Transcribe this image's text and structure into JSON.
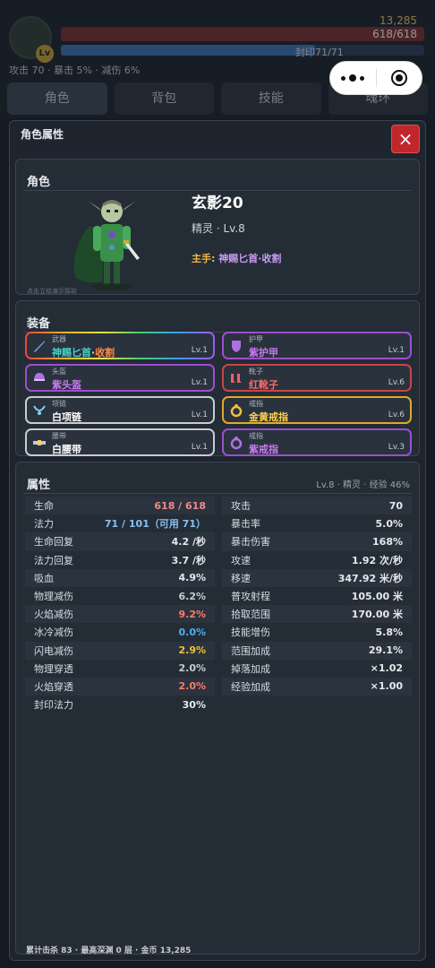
{
  "hud": {
    "gold": "13,285",
    "hp_text": "618/618",
    "seal_text": "封印71/71",
    "statline": "攻击 70  ·  暴击 5%  ·  减伤 6%",
    "tabs": [
      "角色",
      "背包",
      "技能",
      "魂环"
    ]
  },
  "modal": {
    "title": "角色属性",
    "close": "×"
  },
  "character": {
    "section": "角色",
    "name": "玄影20",
    "race_level": "精灵 · Lv.8",
    "mainhand_label": "主手:",
    "mainhand_name": "神赐匕首·收割",
    "hint": "点击立绘演示挥砍"
  },
  "equipment": {
    "section": "装备",
    "slots": [
      {
        "type": "武器",
        "name_a": "神赐匕首",
        "name_b": "·",
        "name_c": "收割",
        "lv": "Lv.1",
        "rarity": "rainbow",
        "icon": "dagger-icon"
      },
      {
        "type": "护甲",
        "name": "紫护甲",
        "lv": "Lv.1",
        "rarity": "purple",
        "icon": "armor-icon"
      },
      {
        "type": "头盔",
        "name": "紫头盔",
        "lv": "Lv.1",
        "rarity": "purple",
        "icon": "helmet-icon"
      },
      {
        "type": "靴子",
        "name": "红靴子",
        "lv": "Lv.6",
        "rarity": "red",
        "icon": "boots-icon"
      },
      {
        "type": "项链",
        "name": "白项链",
        "lv": "Lv.1",
        "rarity": "white",
        "icon": "necklace-icon"
      },
      {
        "type": "戒指",
        "name": "金黄戒指",
        "lv": "Lv.6",
        "rarity": "gold",
        "icon": "ring-icon"
      },
      {
        "type": "腰带",
        "name": "白腰带",
        "lv": "Lv.1",
        "rarity": "white",
        "icon": "belt-icon"
      },
      {
        "type": "戒指",
        "name": "紫戒指",
        "lv": "Lv.3",
        "rarity": "purple",
        "icon": "ring-icon"
      }
    ]
  },
  "attributes": {
    "section": "属性",
    "meta": "Lv.8 · 精灵 · 经验 46%",
    "left": [
      {
        "k": "生命",
        "v": "618 / 618",
        "c": "pink"
      },
      {
        "k": "法力",
        "v": "71 / 101（可用 71）",
        "c": "blue"
      },
      {
        "k": "生命回复",
        "v": "4.2 /秒",
        "c": ""
      },
      {
        "k": "法力回复",
        "v": "3.7 /秒",
        "c": ""
      },
      {
        "k": "吸血",
        "v": "4.9%",
        "c": ""
      },
      {
        "k": "物理减伤",
        "v": "6.2%",
        "c": "gray"
      },
      {
        "k": "火焰减伤",
        "v": "9.2%",
        "c": "red"
      },
      {
        "k": "冰冷减伤",
        "v": "0.0%",
        "c": "cyan"
      },
      {
        "k": "闪电减伤",
        "v": "2.9%",
        "c": "yellow"
      },
      {
        "k": "物理穿透",
        "v": "2.0%",
        "c": "gray"
      },
      {
        "k": "火焰穿透",
        "v": "2.0%",
        "c": "red"
      },
      {
        "k": "封印法力",
        "v": "30%",
        "c": ""
      }
    ],
    "right": [
      {
        "k": "攻击",
        "v": "70",
        "c": ""
      },
      {
        "k": "暴击率",
        "v": "5.0%",
        "c": ""
      },
      {
        "k": "暴击伤害",
        "v": "168%",
        "c": ""
      },
      {
        "k": "攻速",
        "v": "1.92 次/秒",
        "c": ""
      },
      {
        "k": "移速",
        "v": "347.92 米/秒",
        "c": ""
      },
      {
        "k": "普攻射程",
        "v": "105.00 米",
        "c": ""
      },
      {
        "k": "拾取范围",
        "v": "170.00 米",
        "c": ""
      },
      {
        "k": "技能增伤",
        "v": "5.8%",
        "c": ""
      },
      {
        "k": "范围加成",
        "v": "29.1%",
        "c": ""
      },
      {
        "k": "掉落加成",
        "v": "×1.02",
        "c": ""
      },
      {
        "k": "经验加成",
        "v": "×1.00",
        "c": ""
      }
    ]
  },
  "footer": "累计击杀 83 · 最高深渊 0 层 · 金币 13,285",
  "colors": {
    "close_red": "#c0272d",
    "rarity_purple": "#9b4fd0",
    "rarity_red": "#c9454a",
    "rarity_gold": "#e0a92a",
    "rarity_white": "#c8ccd2"
  }
}
